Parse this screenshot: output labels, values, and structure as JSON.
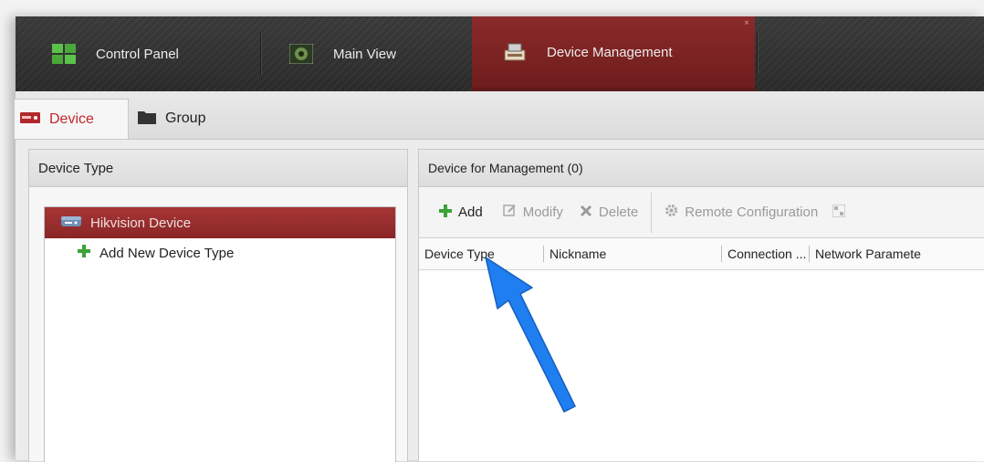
{
  "top_tabs": [
    {
      "label": "Control Panel",
      "icon": "control-panel-icon"
    },
    {
      "label": "Main View",
      "icon": "main-view-icon"
    },
    {
      "label": "Device Management",
      "icon": "device-management-icon",
      "active": true
    }
  ],
  "top_tab_close": "×",
  "sub_tabs": [
    {
      "label": "Device",
      "icon": "device-icon",
      "active": true
    },
    {
      "label": "Group",
      "icon": "folder-icon"
    }
  ],
  "device_type_panel": {
    "title": "Device Type",
    "items": [
      {
        "label": "Hikvision Device",
        "icon": "dvr-icon",
        "selected": true
      },
      {
        "label": "Add New Device Type",
        "icon": "plus-icon"
      }
    ]
  },
  "management_panel": {
    "title": "Device for Management (0)",
    "toolbar": {
      "add": "Add",
      "modify": "Modify",
      "delete": "Delete",
      "remote_config": "Remote Configuration"
    },
    "columns": [
      "Device Type",
      "Nickname",
      "Connection ...",
      "Network Paramete"
    ]
  },
  "colors": {
    "accent": "#8b2a2a",
    "plus_green": "#3aa335",
    "arrow_blue": "#1f7ef0"
  }
}
